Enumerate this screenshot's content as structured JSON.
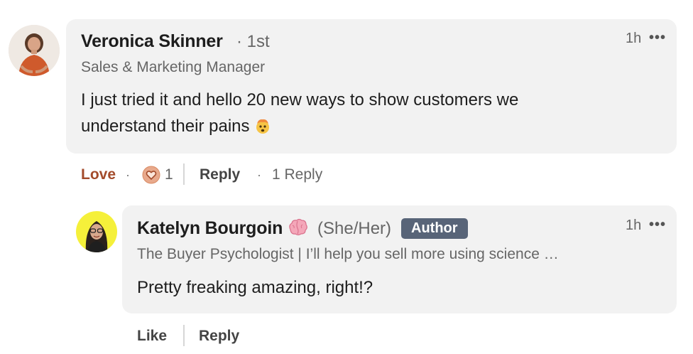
{
  "comment": {
    "author_name": "Veronica Skinner",
    "degree": "1st",
    "headline": "Sales & Marketing Manager",
    "time": "1h",
    "more": "•••",
    "text": "I just tried it and hello 20 new ways to show customers we understand their pains",
    "emoji": "exploding-head-emoji",
    "actions": {
      "love_label": "Love",
      "dot": "·",
      "reaction_count": "1",
      "reply_label": "Reply",
      "replies_label": "1 Reply"
    }
  },
  "reply": {
    "author_name": "Katelyn Bourgoin",
    "brain_icon": "brain-emoji",
    "pronouns": "(She/Her)",
    "badge": "Author",
    "headline": "The Buyer Psychologist | I’ll help you sell more using science …",
    "time": "1h",
    "more": "•••",
    "text": "Pretty freaking amazing, right!?",
    "actions": {
      "like_label": "Like",
      "reply_label": "Reply"
    }
  },
  "colors": {
    "bubble": "#f2f2f2",
    "love": "#a34b2b",
    "badge": "#586478",
    "reply_avatar_bg": "#f5f03a"
  }
}
